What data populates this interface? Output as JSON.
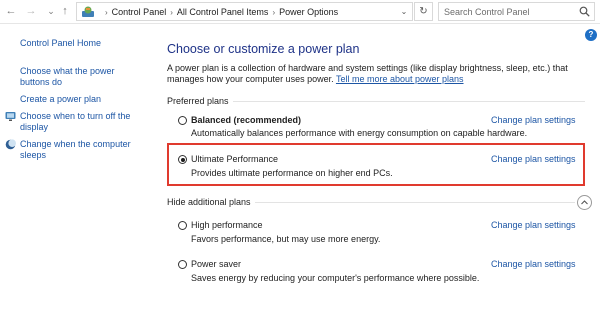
{
  "address_bar": {
    "back": "←",
    "forward": "→",
    "recent": "⌄",
    "up": "↑",
    "crumbs": [
      "Control Panel",
      "All Control Panel Items",
      "Power Options"
    ],
    "separator": "›",
    "refresh": "↻",
    "search_placeholder": "Search Control Panel"
  },
  "help": "?",
  "left_nav": {
    "home": "Control Panel Home",
    "items": [
      "Choose what the power buttons do",
      "Create a power plan",
      "Choose when to turn off the display",
      "Change when the computer sleeps"
    ]
  },
  "main": {
    "title": "Choose or customize a power plan",
    "description": "A power plan is a collection of hardware and system settings (like display brightness, sleep, etc.) that manages how your computer uses power.",
    "description_link": "Tell me more about power plans",
    "preferred_label": "Preferred plans",
    "additional_label": "Hide additional plans",
    "change_link": "Change plan settings",
    "preferred_plans": [
      {
        "name": "Balanced (recommended)",
        "desc": "Automatically balances performance with energy consumption on capable hardware.",
        "selected": false
      },
      {
        "name": "Ultimate Performance",
        "desc": "Provides ultimate performance on higher end PCs.",
        "selected": true
      }
    ],
    "additional_plans": [
      {
        "name": "High performance",
        "desc": "Favors performance, but may use more energy.",
        "selected": false
      },
      {
        "name": "Power saver",
        "desc": "Saves energy by reducing your computer's performance where possible.",
        "selected": false
      }
    ]
  },
  "colors": {
    "link": "#1d56a5",
    "title": "#1e3287",
    "highlight": "#e03a2e"
  }
}
